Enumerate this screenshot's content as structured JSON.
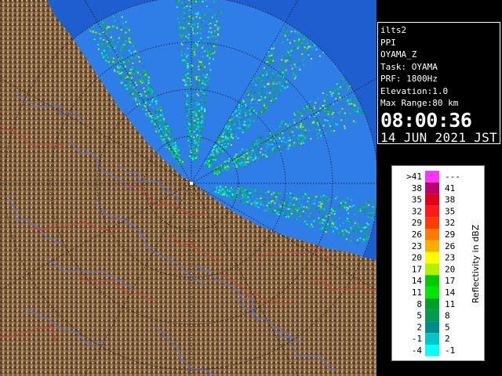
{
  "info": {
    "lines": [
      "ilts2",
      "PPI",
      "OYAMA_Z",
      "Task: OYAMA",
      "PRF: 1800Hz",
      "Elevation:1.0",
      "Max Range:80 km"
    ],
    "time": "08:00:36",
    "date": "14 JUN 2021 JST"
  },
  "legend": {
    "title": "Reflectivity in dBZ",
    "bins": [
      {
        "low": ">41",
        "high": "---",
        "color": "#ff33ff"
      },
      {
        "low": "38",
        "high": "41",
        "color": "#b8006e"
      },
      {
        "low": "35",
        "high": "38",
        "color": "#e0001c"
      },
      {
        "low": "32",
        "high": "35",
        "color": "#ff1a1a"
      },
      {
        "low": "29",
        "high": "32",
        "color": "#ff3b00"
      },
      {
        "low": "26",
        "high": "29",
        "color": "#ff7a00"
      },
      {
        "low": "23",
        "high": "26",
        "color": "#ffad00"
      },
      {
        "low": "20",
        "high": "23",
        "color": "#ffff00"
      },
      {
        "low": "17",
        "high": "20",
        "color": "#b2f000"
      },
      {
        "low": "14",
        "high": "17",
        "color": "#00c800"
      },
      {
        "low": "11",
        "high": "14",
        "color": "#00e600"
      },
      {
        "low": "8",
        "high": "11",
        "color": "#00a028"
      },
      {
        "low": "5",
        "high": "8",
        "color": "#009a50"
      },
      {
        "low": "2",
        "high": "5",
        "color": "#008c8c"
      },
      {
        "low": "-1",
        "high": "2",
        "color": "#00c8c8"
      },
      {
        "low": "-4",
        "high": "-1",
        "color": "#00ffff"
      }
    ]
  },
  "colors": {
    "sea": "#2b6fdc",
    "range_disc": "#3a8ef0",
    "land_dark": "#4a3220",
    "land_light": "#a0805a",
    "river": "#5a6ad8",
    "boundary": "#d04040"
  }
}
